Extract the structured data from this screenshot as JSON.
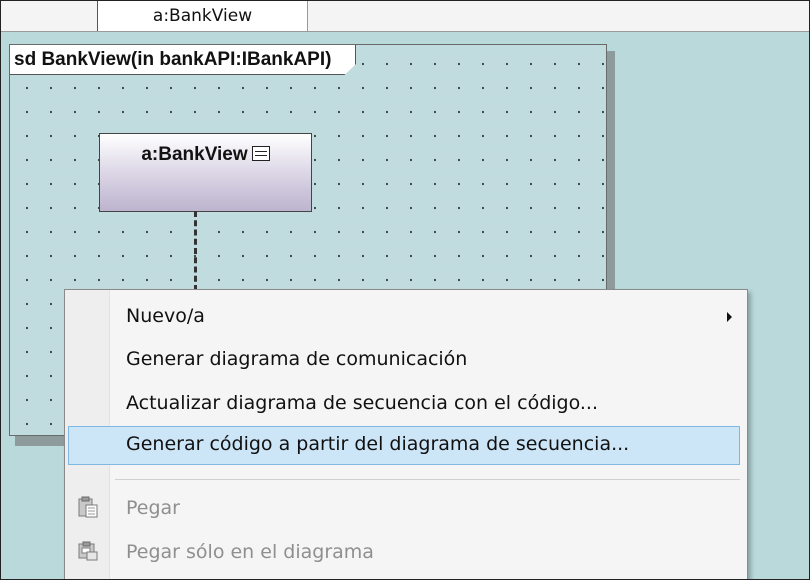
{
  "tab": {
    "label": "a:BankView"
  },
  "diagram": {
    "frame_label": "sd BankView(in bankAPI:IBankAPI)",
    "lifeline": {
      "label": "a:BankView",
      "icon": "collapse-icon"
    }
  },
  "context_menu": {
    "items": [
      {
        "label": "Nuevo/a",
        "submenu": true,
        "enabled": true
      },
      {
        "label": "Generar diagrama de comunicación",
        "enabled": true
      },
      {
        "label": "Actualizar diagrama de secuencia con el código...",
        "enabled": true
      },
      {
        "label": "Generar código a partir del diagrama de secuencia...",
        "enabled": true,
        "highlighted": true
      },
      {
        "label": "Pegar",
        "enabled": false,
        "icon": "clipboard-paste-icon"
      },
      {
        "label": "Pegar sólo en el diagrama",
        "enabled": false,
        "icon": "clipboard-paste-diagram-icon"
      }
    ]
  },
  "colors": {
    "background": "#b9d9db",
    "highlight": "#cce5f7",
    "highlight_border": "#7fb8e3",
    "disabled_text": "#8f8f8f"
  }
}
